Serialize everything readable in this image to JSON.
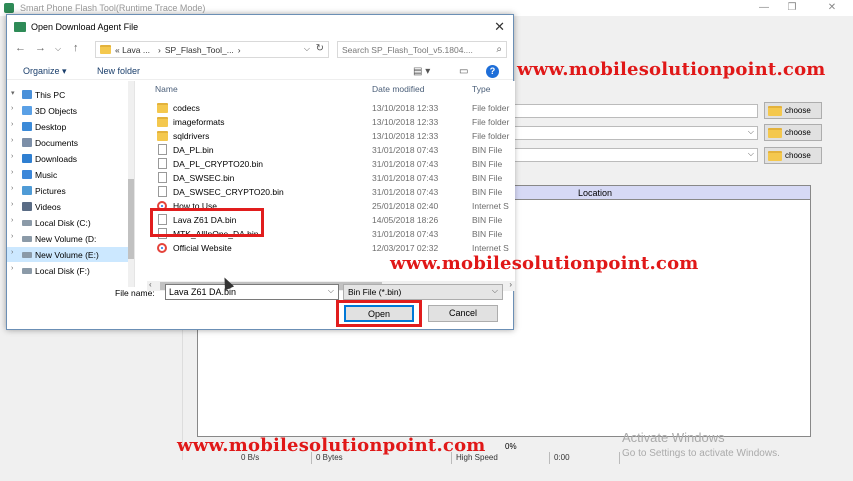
{
  "app": {
    "title": "Smart Phone Flash Tool(Runtime Trace Mode)",
    "choose_label": "choose",
    "table_header_location": "Location",
    "status": {
      "speed": "0 B/s",
      "bytes": "0 Bytes",
      "mode": "High Speed",
      "time": "0:00",
      "progress": "0%"
    }
  },
  "dialog": {
    "title": "Open Download Agent File",
    "breadcrumb": [
      "«  Lava ...",
      "SP_Flash_Tool_..."
    ],
    "search_placeholder": "Search SP_Flash_Tool_v5.1804....",
    "organize_label": "Organize ▾",
    "new_folder_label": "New folder",
    "nav_items": [
      {
        "label": "This PC",
        "icon": "this-pc-icon",
        "color": "#4a90d9"
      },
      {
        "label": "3D Objects",
        "icon": "cube-icon",
        "color": "#5aa0e6"
      },
      {
        "label": "Desktop",
        "icon": "desktop-icon",
        "color": "#3b8ad8"
      },
      {
        "label": "Documents",
        "icon": "documents-icon",
        "color": "#7c8fa8"
      },
      {
        "label": "Downloads",
        "icon": "download-icon",
        "color": "#2f7fd1"
      },
      {
        "label": "Music",
        "icon": "music-icon",
        "color": "#3c87d9"
      },
      {
        "label": "Pictures",
        "icon": "pictures-icon",
        "color": "#4f9bd6"
      },
      {
        "label": "Videos",
        "icon": "videos-icon",
        "color": "#5a6c85"
      },
      {
        "label": "Local Disk (C:)",
        "icon": "drive-icon",
        "color": "#8b9aa8"
      },
      {
        "label": "New Volume (D:",
        "icon": "drive-icon",
        "color": "#8b9aa8"
      },
      {
        "label": "New Volume (E:)",
        "icon": "drive-icon",
        "color": "#8b9aa8",
        "selected": true
      },
      {
        "label": "Local Disk (F:)",
        "icon": "drive-icon",
        "color": "#8b9aa8"
      }
    ],
    "columns": {
      "name": "Name",
      "date": "Date modified",
      "type": "Type"
    },
    "files": [
      {
        "name": "codecs",
        "date": "13/10/2018 12:33",
        "type": "File folder",
        "kind": "folder"
      },
      {
        "name": "imageformats",
        "date": "13/10/2018 12:33",
        "type": "File folder",
        "kind": "folder"
      },
      {
        "name": "sqldrivers",
        "date": "13/10/2018 12:33",
        "type": "File folder",
        "kind": "folder"
      },
      {
        "name": "DA_PL.bin",
        "date": "31/01/2018 07:43",
        "type": "BIN File",
        "kind": "file"
      },
      {
        "name": "DA_PL_CRYPTO20.bin",
        "date": "31/01/2018 07:43",
        "type": "BIN File",
        "kind": "file"
      },
      {
        "name": "DA_SWSEC.bin",
        "date": "31/01/2018 07:43",
        "type": "BIN File",
        "kind": "file"
      },
      {
        "name": "DA_SWSEC_CRYPTO20.bin",
        "date": "31/01/2018 07:43",
        "type": "BIN File",
        "kind": "file"
      },
      {
        "name": "How to Use",
        "date": "25/01/2018 02:40",
        "type": "Internet S",
        "kind": "web"
      },
      {
        "name": "Lava Z61 DA.bin",
        "date": "14/05/2018 18:26",
        "type": "BIN File",
        "kind": "file"
      },
      {
        "name": "MTK_AllInOne_DA.bin",
        "date": "31/01/2018 07:43",
        "type": "BIN File",
        "kind": "file"
      },
      {
        "name": "Official Website",
        "date": "12/03/2017 02:32",
        "type": "Internet S",
        "kind": "web"
      }
    ],
    "filename_label": "File name:",
    "filename_value": "Lava Z61 DA.bin",
    "filetype_value": "Bin File (*.bin)",
    "open_label": "Open",
    "cancel_label": "Cancel"
  },
  "watermark": "www.mobilesolutionpoint.com",
  "activate": {
    "line1": "Activate Windows",
    "line2": "Go to Settings to activate Windows."
  }
}
